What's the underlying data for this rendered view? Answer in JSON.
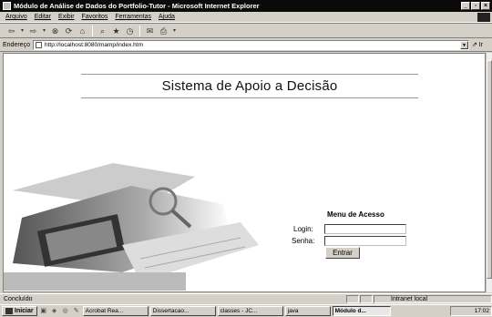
{
  "window": {
    "title": "Módulo de Análise de Dados do Portfolio-Tutor - Microsoft Internet Explorer"
  },
  "menu": {
    "items": [
      "Arquivo",
      "Editar",
      "Exibir",
      "Favoritos",
      "Ferramentas",
      "Ajuda"
    ]
  },
  "address": {
    "label": "Endereço",
    "url": "http://localhost:8080/mamp/index.htm",
    "go": "⇗ Ir"
  },
  "page": {
    "title": "Sistema de Apoio a Decisão"
  },
  "login": {
    "heading": "Menu de Acesso",
    "login_label": "Login:",
    "senha_label": "Senha:",
    "login_value": "",
    "senha_value": "",
    "submit_label": "Entrar"
  },
  "status": {
    "text": "Concluído",
    "zone": "Intranet local"
  },
  "taskbar": {
    "start_label": "Iniciar",
    "tasks": [
      "Acrobat Rea...",
      "Dissertacao...",
      "classes - JC...",
      "java",
      "Módulo d..."
    ],
    "clock": "17:02"
  },
  "colors": {
    "titlebar": "#0a0a0a",
    "chrome": "#d4d0c8",
    "content": "#ffffff"
  }
}
